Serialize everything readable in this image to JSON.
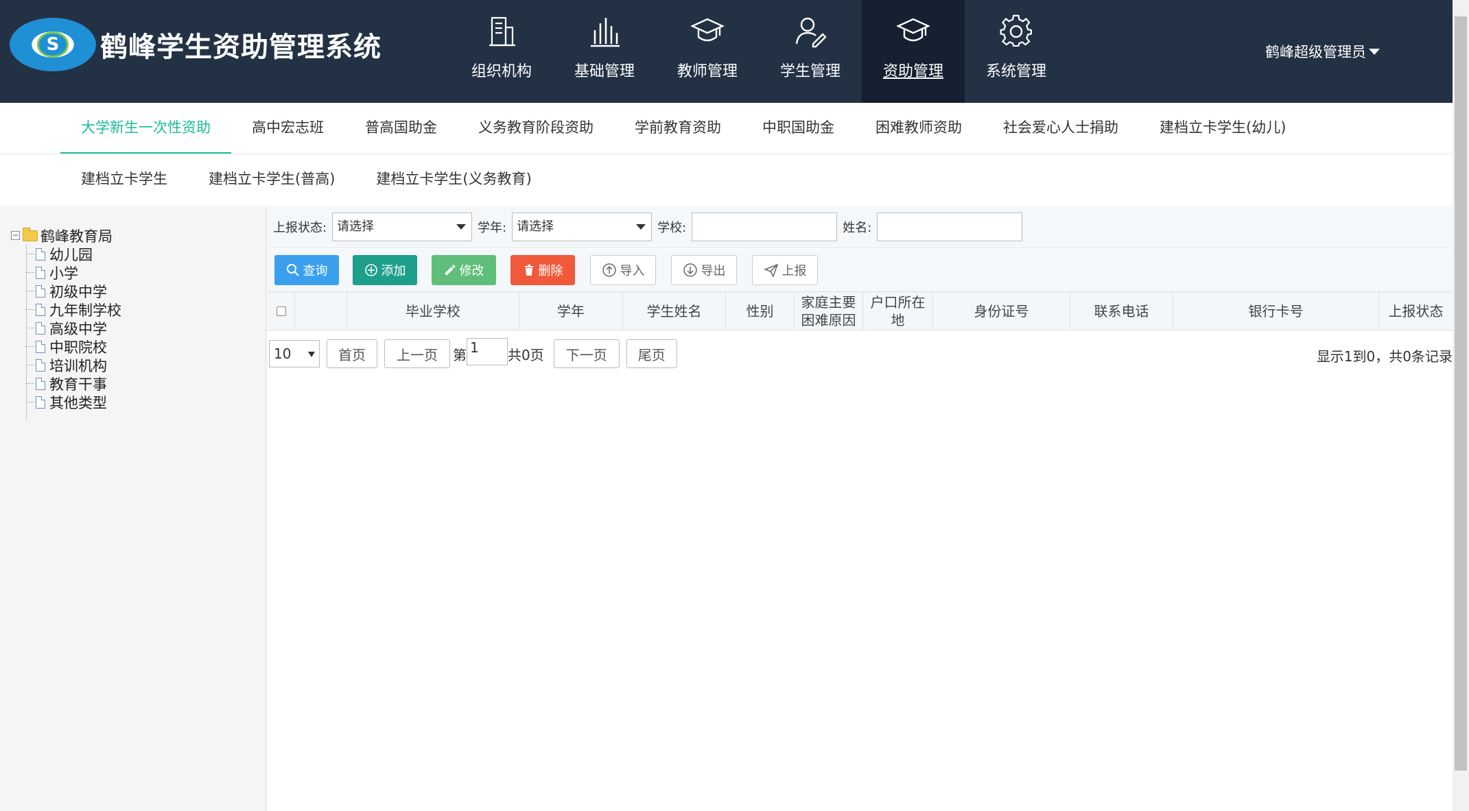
{
  "app": {
    "title": "鹤峰学生资助管理系统",
    "logo_text": "S"
  },
  "topnav": [
    {
      "label": "组织机构",
      "icon": "building-icon"
    },
    {
      "label": "基础管理",
      "icon": "bar-chart-icon"
    },
    {
      "label": "教师管理",
      "icon": "graduation-cap-icon"
    },
    {
      "label": "学生管理",
      "icon": "user-edit-icon"
    },
    {
      "label": "资助管理",
      "icon": "graduation-cap-icon",
      "active": true
    },
    {
      "label": "系统管理",
      "icon": "gear-icon"
    }
  ],
  "user": {
    "name": "鹤峰超级管理员"
  },
  "subnav": {
    "row1": [
      "大学新生一次性资助",
      "高中宏志班",
      "普高国助金",
      "义务教育阶段资助",
      "学前教育资助",
      "中职国助金",
      "困难教师资助",
      "社会爱心人士捐助",
      "建档立卡学生(幼儿)"
    ],
    "row2": [
      "建档立卡学生",
      "建档立卡学生(普高)",
      "建档立卡学生(义务教育)"
    ],
    "active": "大学新生一次性资助"
  },
  "tree": {
    "root": "鹤峰教育局",
    "children": [
      "幼儿园",
      "小学",
      "初级中学",
      "九年制学校",
      "高级中学",
      "中职院校",
      "培训机构",
      "教育干事",
      "其他类型"
    ]
  },
  "filters": {
    "status_label": "上报状态:",
    "status_value": "请选择",
    "year_label": "学年:",
    "year_value": "请选择",
    "school_label": "学校:",
    "name_label": "姓名:"
  },
  "toolbar": {
    "query": "查询",
    "add": "添加",
    "edit": "修改",
    "delete": "删除",
    "import": "导入",
    "export": "导出",
    "report": "上报"
  },
  "table": {
    "columns": [
      "毕业学校",
      "学年",
      "学生姓名",
      "性别",
      "家庭主要困难原因",
      "户口所在地",
      "身份证号",
      "联系电话",
      "银行卡号",
      "上报状态"
    ]
  },
  "pager": {
    "page_size": "10",
    "first": "首页",
    "prev": "上一页",
    "page_prefix": "第",
    "page_value": "1",
    "page_total": "共0页",
    "next": "下一页",
    "last": "尾页",
    "summary": "显示1到0，共0条记录"
  },
  "colors": {
    "header_bg": "#233144",
    "active_tab": "#1abc9c",
    "btn_query": "#3aa0ee",
    "btn_add": "#1e9f8b",
    "btn_edit": "#5fbf7a",
    "btn_delete": "#f05a3a"
  }
}
